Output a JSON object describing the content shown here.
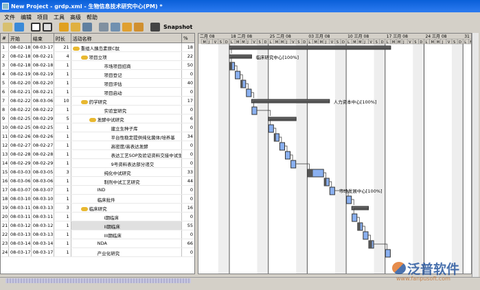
{
  "title": "New Project - grdp.xml - 生物信息技术研究中心(PM) *",
  "menu": [
    "文件",
    "编辑",
    "项目",
    "工具",
    "高级",
    "帮助"
  ],
  "toolbar": {
    "snapshot": "Snapshot"
  },
  "columns": [
    "#",
    "开始",
    "结束",
    "时长",
    "活动名称",
    "%"
  ],
  "timeline": {
    "partial_left": "二月 08",
    "weeks": [
      "18 二月 08",
      "25 二月 08",
      "03 三月 08",
      "10 三月 08",
      "17 三月 08",
      "24 三月 08",
      "31"
    ],
    "days": [
      "L",
      "M",
      "M",
      "J",
      "V",
      "S",
      "D"
    ]
  },
  "tasks": [
    {
      "n": "1",
      "s": "08-02-18",
      "e": "08-03-17",
      "d": "21",
      "name": "重组人胰岛素原C肽",
      "p": "18",
      "level": 0,
      "group": true
    },
    {
      "n": "2",
      "s": "08-02-18",
      "e": "08-02-21",
      "d": "4",
      "name": "项目立项",
      "p": "22",
      "level": 1,
      "group": true,
      "res": "临床研究中心[100%]"
    },
    {
      "n": "3",
      "s": "08-02-18",
      "e": "08-02-18",
      "d": "1",
      "name": "市场项目招商",
      "p": "50",
      "level": 3
    },
    {
      "n": "4",
      "s": "08-02-19",
      "e": "08-02-19",
      "d": "1",
      "name": "项目登记",
      "p": "0",
      "level": 3
    },
    {
      "n": "5",
      "s": "08-02-20",
      "e": "08-02-20",
      "d": "1",
      "name": "项目评估",
      "p": "40",
      "level": 3
    },
    {
      "n": "6",
      "s": "08-02-21",
      "e": "08-02-21",
      "d": "1",
      "name": "项目启动",
      "p": "0",
      "level": 3
    },
    {
      "n": "7",
      "s": "08-02-22",
      "e": "08-03-06",
      "d": "10",
      "name": "药学研究",
      "p": "17",
      "level": 1,
      "group": true,
      "res": "人力资本中心[100%]"
    },
    {
      "n": "8",
      "s": "08-02-22",
      "e": "08-02-22",
      "d": "1",
      "name": "实验室研究",
      "p": "0",
      "level": 3
    },
    {
      "n": "9",
      "s": "08-02-25",
      "e": "08-02-29",
      "d": "5",
      "name": "发酵中试研究",
      "p": "6",
      "level": 2,
      "group": true
    },
    {
      "n": "10",
      "s": "08-02-25",
      "e": "08-02-25",
      "d": "1",
      "name": "建立生种子库",
      "p": "0",
      "level": 4
    },
    {
      "n": "11",
      "s": "08-02-26",
      "e": "08-02-26",
      "d": "1",
      "name": "平台性稳定提供纯化菌体/培养基",
      "p": "34",
      "level": 4
    },
    {
      "n": "12",
      "s": "08-02-27",
      "e": "08-02-27",
      "d": "1",
      "name": "高密度/高表达发酵",
      "p": "0",
      "level": 4
    },
    {
      "n": "13",
      "s": "08-02-28",
      "e": "08-02-28",
      "d": "1",
      "name": "表达工艺SOP及验证资料交接中试生产",
      "p": "0",
      "level": 4
    },
    {
      "n": "14",
      "s": "08-02-29",
      "e": "08-02-29",
      "d": "1",
      "name": "9号资料表达部分递交",
      "p": "0",
      "level": 4
    },
    {
      "n": "15",
      "s": "08-03-03",
      "e": "08-03-05",
      "d": "3",
      "name": "纯化中试研究",
      "p": "33",
      "level": 3
    },
    {
      "n": "16",
      "s": "08-03-06",
      "e": "08-03-06",
      "d": "1",
      "name": "制剂中试工艺研究",
      "p": "44",
      "level": 3
    },
    {
      "n": "17",
      "s": "08-03-07",
      "e": "08-03-07",
      "d": "1",
      "name": "IND",
      "p": "0",
      "level": 2,
      "res": "市场发展中心[100%]"
    },
    {
      "n": "18",
      "s": "08-03-10",
      "e": "08-03-10",
      "d": "1",
      "name": "临床批件",
      "p": "0",
      "level": 2
    },
    {
      "n": "19",
      "s": "08-03-11",
      "e": "08-03-13",
      "d": "3",
      "name": "临床研究",
      "p": "16",
      "level": 1,
      "group": true
    },
    {
      "n": "20",
      "s": "08-03-11",
      "e": "08-03-11",
      "d": "1",
      "name": "I期临床",
      "p": "0",
      "level": 3
    },
    {
      "n": "21",
      "s": "08-03-12",
      "e": "08-03-12",
      "d": "1",
      "name": "II期临床",
      "p": "55",
      "level": 3,
      "sel": true
    },
    {
      "n": "22",
      "s": "08-03-13",
      "e": "08-03-13",
      "d": "1",
      "name": "III期临床",
      "p": "0",
      "level": 3
    },
    {
      "n": "23",
      "s": "08-03-14",
      "e": "08-03-14",
      "d": "1",
      "name": "NDA",
      "p": "66",
      "level": 2
    },
    {
      "n": "24",
      "s": "08-03-17",
      "e": "08-03-17",
      "d": "1",
      "name": "产业化研究",
      "p": "0",
      "level": 2
    }
  ],
  "watermark": {
    "brand": "泛普软件",
    "url": "www.fanpusoft.com"
  }
}
